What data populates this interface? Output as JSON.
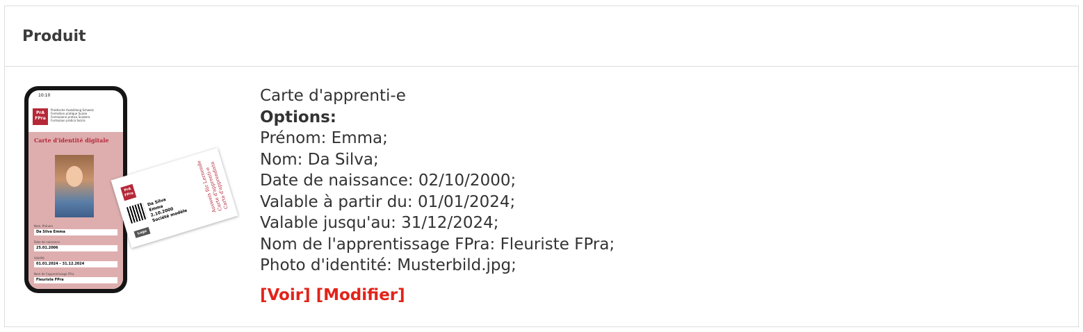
{
  "table": {
    "header_label": "Produit"
  },
  "product": {
    "name": "Carte d'apprenti-e",
    "options_label": "Options:",
    "options": [
      "Prénom: Emma;",
      "Nom: Da Silva;",
      "Date de naissance: 02/10/2000;",
      "Valable à partir du: 01/01/2024;",
      "Valable jusqu'au: 31/12/2024;",
      "Nom de l'apprentissage FPra: Fleuriste FPra;",
      "Photo d'identité: Musterbild.jpg;"
    ],
    "actions": {
      "view": "[Voir]",
      "edit": "[Modifier]"
    }
  },
  "thumbnail": {
    "phone_time": "10:10",
    "brand_mark": "PrA FPra",
    "brand_lines": [
      "Praktische Ausbildung Schweiz",
      "Formation pratique Suisse",
      "Formazione pratica Svizzera",
      "Furmaziun pratica Svizra"
    ],
    "card_title": "Carte d'identité digitale",
    "fields": [
      {
        "label": "Nom, Prénom",
        "value": "Da Silva Emma"
      },
      {
        "label": "Date de naissance",
        "value": "25.01.2006"
      },
      {
        "label": "Validité",
        "value": "01.01.2024 – 31.12.2024"
      },
      {
        "label": "Nom de l'apprentissage FPra",
        "value": "Fleuriste FPra"
      }
    ],
    "card_name_1": "Da Silva",
    "card_name_2": "Emma",
    "card_date": "2.10.2000",
    "card_logo": "Logo",
    "card_company": "Société modèle",
    "card_vertical": [
      "Ausweis für Lernende",
      "Carte d'apprenti-e",
      "Carta d'apprendista"
    ],
    "colors": {
      "brand": "#b52838",
      "card_pink": "#deaeaf"
    }
  }
}
